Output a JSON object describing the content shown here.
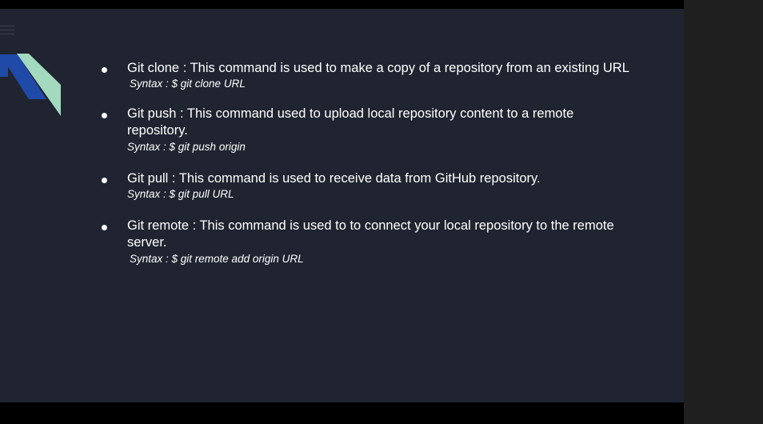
{
  "slide": {
    "background": "#1f2430",
    "accent_blue": "#1f4aa8",
    "accent_mint": "#a3d9bf",
    "bullets": [
      {
        "text": "Git clone : This command is used to make a copy of a repository from an existing URL",
        "syntax": "Syntax :  $ git clone URL"
      },
      {
        "text": "Git push : This command used to upload local repository content to a remote repository.",
        "syntax": "Syntax : $ git push origin"
      },
      {
        "text": "Git pull : This command is used to receive data from GitHub repository.",
        "syntax": "Syntax : $ git pull URL"
      },
      {
        "text": "Git remote : This command is used to to connect your local repository to the remote server.",
        "syntax": "Syntax : $ git remote add origin URL"
      }
    ]
  },
  "icons": {
    "menu": "hamburger-menu-icon",
    "decoration": "diagonal-stripes-decoration"
  }
}
